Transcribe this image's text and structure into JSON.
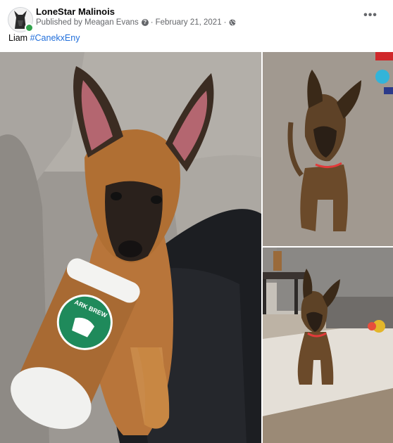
{
  "post": {
    "page_name": "LoneStar Malinois",
    "published_by": "Published by Meagan Evans",
    "question_icon": "?",
    "date": "February 21, 2021",
    "separator": "·",
    "audience_icon": "globe-icon",
    "more_label": "•••",
    "caption_text": "Liam",
    "caption_hashtag": "#CanekxEny"
  },
  "photos": {
    "main_cup_label": "ARK BREW"
  },
  "colors": {
    "link": "#216fdb",
    "online": "#31a24c",
    "secondary_text": "#65676b"
  }
}
